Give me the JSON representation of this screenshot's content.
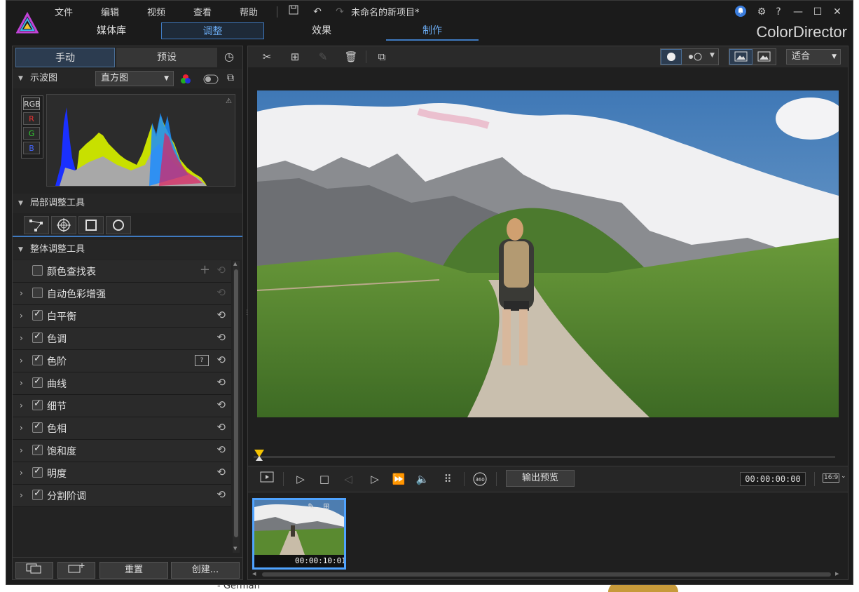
{
  "background_page": {
    "text": "- German"
  },
  "titlebar": {
    "menu": [
      "文件",
      "编辑",
      "视频",
      "查看",
      "帮助"
    ],
    "project_title": "未命名的新项目*",
    "window_buttons": [
      "notification-icon",
      "settings-icon",
      "help-icon",
      "minimize-icon",
      "maximize-icon",
      "close-icon"
    ],
    "help_glyph": "?"
  },
  "tabs": {
    "media": "媒体库",
    "adjust": "调整",
    "effects": "效果",
    "produce": "制作"
  },
  "brand": "ColorDirector",
  "left_panel": {
    "tab_manual": "手动",
    "tab_preset": "预设",
    "histogram_section": {
      "title": "示波图",
      "dropdown_value": "直方图",
      "channels": [
        "RGB",
        "R",
        "G",
        "B"
      ]
    },
    "local_tools": {
      "title": "局部调整工具",
      "tools": [
        "gradient-mask-icon",
        "radial-mask-icon",
        "rectangle-mask-icon",
        "circle-mask-icon"
      ]
    },
    "global_tools": {
      "title": "整体调整工具",
      "items": [
        {
          "label": "颜色查找表",
          "checked": false,
          "expandable": false
        },
        {
          "label": "自动色彩增强",
          "checked": false,
          "expandable": true
        },
        {
          "label": "白平衡",
          "checked": true,
          "expandable": true
        },
        {
          "label": "色调",
          "checked": true,
          "expandable": true
        },
        {
          "label": "色阶",
          "checked": true,
          "expandable": true
        },
        {
          "label": "曲线",
          "checked": true,
          "expandable": true
        },
        {
          "label": "细节",
          "checked": true,
          "expandable": true
        },
        {
          "label": "色相",
          "checked": true,
          "expandable": true
        },
        {
          "label": "饱和度",
          "checked": true,
          "expandable": true
        },
        {
          "label": "明度",
          "checked": true,
          "expandable": true
        },
        {
          "label": "分割阶调",
          "checked": true,
          "expandable": true
        }
      ]
    },
    "bottom_buttons": {
      "reset": "重置",
      "create": "创建..."
    }
  },
  "main": {
    "fit_dropdown": "适合",
    "export_preview": "输出预览",
    "timecode": "00:00:00:00",
    "aspect_label": "16:9",
    "badge_360": "360",
    "clip": {
      "duration": "00:00:10:01"
    }
  }
}
